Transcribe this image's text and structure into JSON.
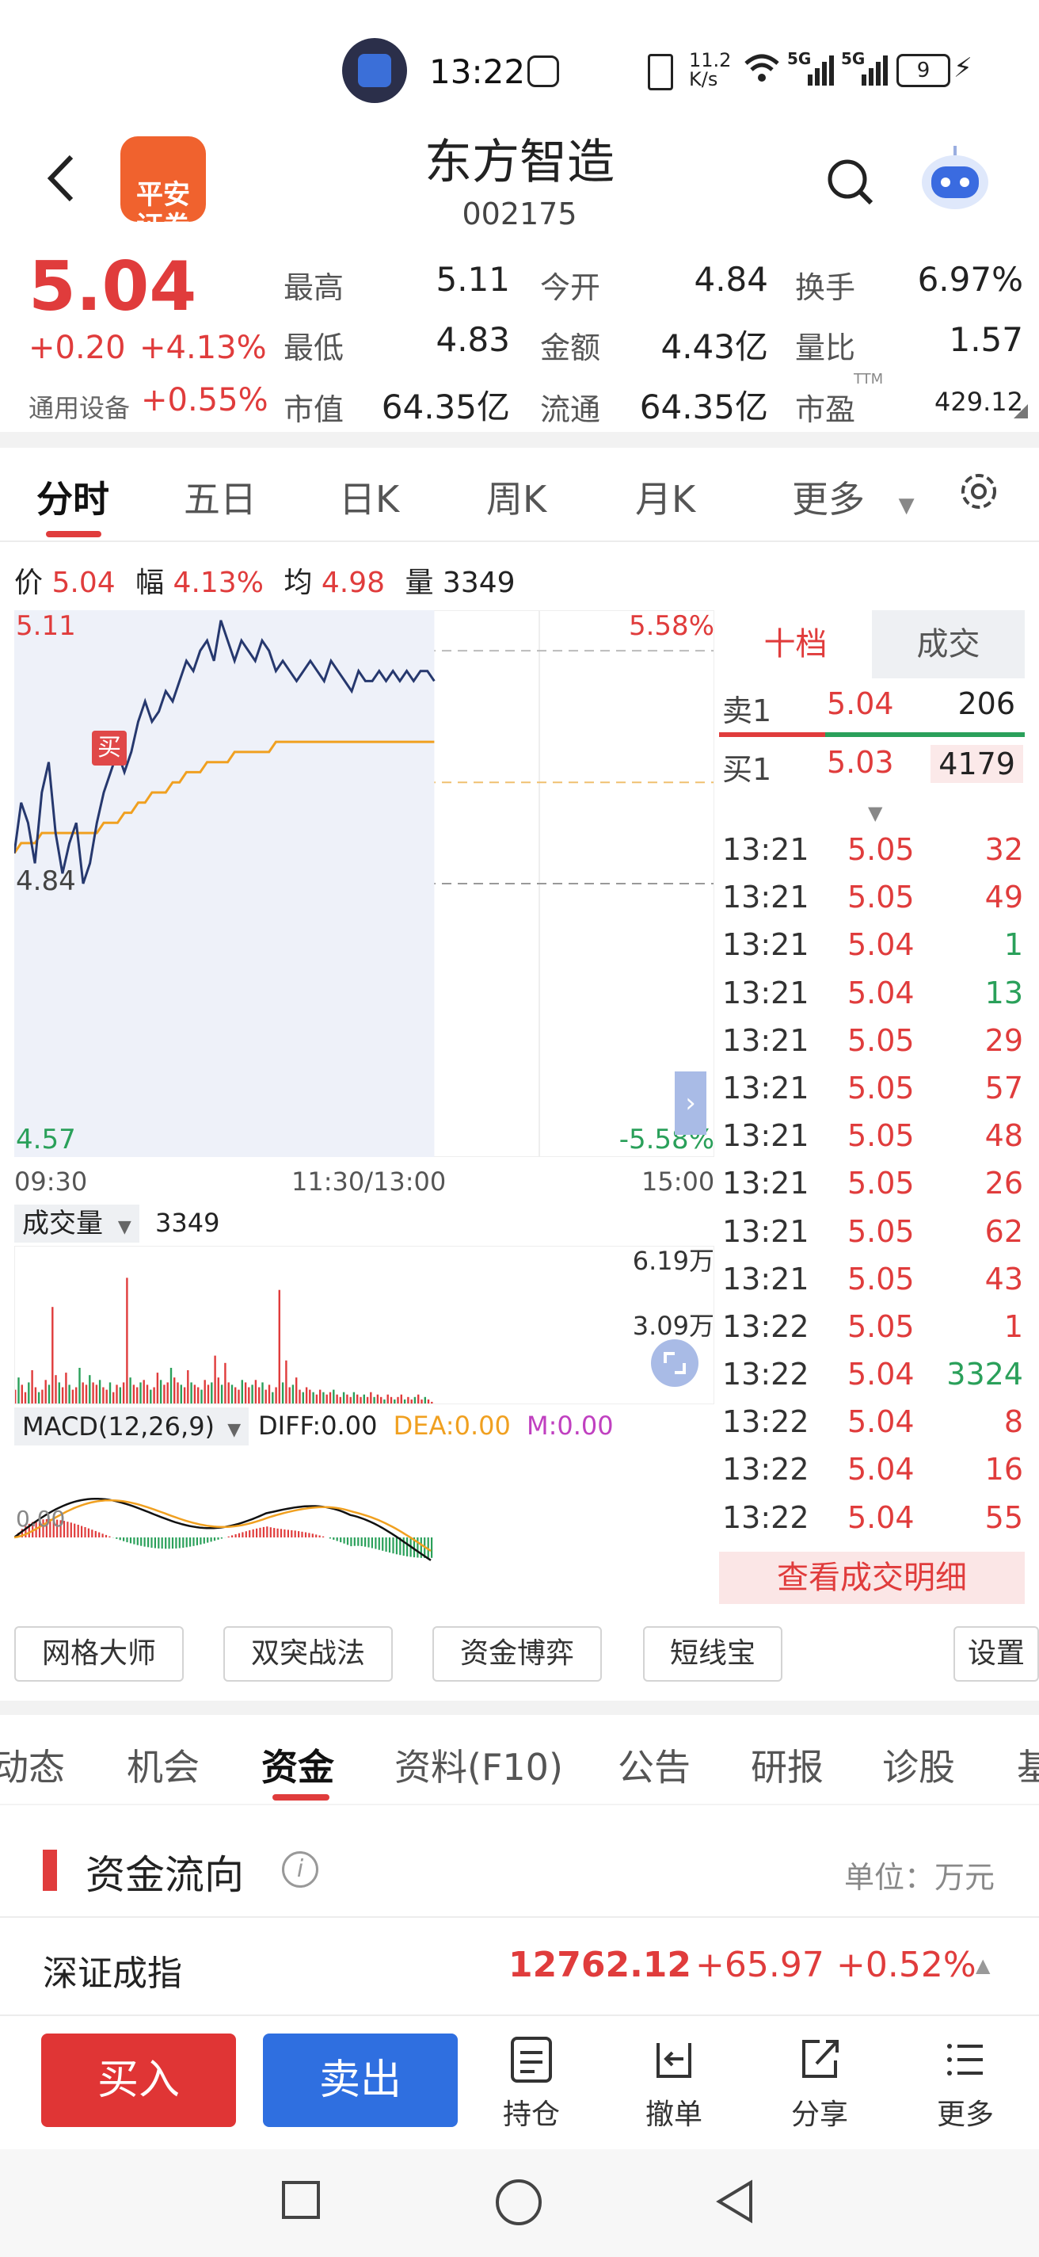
{
  "status_bar": {
    "time": "13:22",
    "net_speed_top": "11.2",
    "net_speed_bottom": "K/s",
    "signal_1": "5G",
    "signal_2": "5G",
    "battery": "9"
  },
  "header": {
    "broker_logo_text": "平安\n证券",
    "stock_name": "东方智造",
    "stock_code": "002175"
  },
  "quote": {
    "price": "5.04",
    "change": "+0.20",
    "change_pct": "+4.13%",
    "sector": "通用设备",
    "sector_pct": "+0.55%",
    "high_label": "最高",
    "high": "5.11",
    "open_label": "今开",
    "open": "4.84",
    "turnover_label": "换手",
    "turnover": "6.97%",
    "low_label": "最低",
    "low": "4.83",
    "amount_label": "金额",
    "amount": "4.43亿",
    "vol_ratio_label": "量比",
    "vol_ratio": "1.57",
    "mcap_label": "市值",
    "mcap": "64.35亿",
    "float_label": "流通",
    "float": "64.35亿",
    "pe_label": "市盈",
    "pe_sup": "TTM",
    "pe": "429.12"
  },
  "chart_tabs": [
    "分时",
    "五日",
    "日K",
    "周K",
    "月K",
    "更多"
  ],
  "chart_info": {
    "price_label": "价",
    "price": "5.04",
    "pct_label": "幅",
    "pct": "4.13%",
    "avg_label": "均",
    "avg": "4.98",
    "vol_label": "量",
    "vol": "3349"
  },
  "chart_data": [
    {
      "type": "line",
      "title": "",
      "x_labels": [
        "09:30",
        "11:30/13:00",
        "15:00"
      ],
      "y_left": [
        "5.11",
        "4.84",
        "4.57"
      ],
      "y_right": [
        "5.58%",
        "-5.58%"
      ],
      "ylim": [
        4.57,
        5.11
      ],
      "marker": "买",
      "series": [
        {
          "values": [
            4.87,
            4.92,
            4.9,
            4.86,
            4.93,
            4.96,
            4.89,
            4.85,
            4.88,
            4.9,
            4.84,
            4.86,
            4.9,
            4.93,
            4.95,
            4.97,
            4.95,
            4.97,
            5.0,
            5.02,
            5.0,
            5.01,
            5.03,
            5.02,
            5.04,
            5.06,
            5.05,
            5.07,
            5.08,
            5.06,
            5.1,
            5.08,
            5.06,
            5.08,
            5.07,
            5.06,
            5.08,
            5.07,
            5.05,
            5.06,
            5.05,
            5.04,
            5.05,
            5.06,
            5.05,
            5.04,
            5.06,
            5.05,
            5.04,
            5.03,
            5.05,
            5.04,
            5.04,
            5.05,
            5.04,
            5.05,
            5.04,
            5.05,
            5.04,
            5.05,
            5.05,
            5.04
          ]
        },
        {
          "values": [
            4.87,
            4.88,
            4.88,
            4.88,
            4.89,
            4.89,
            4.89,
            4.89,
            4.89,
            4.89,
            4.89,
            4.89,
            4.89,
            4.9,
            4.9,
            4.9,
            4.91,
            4.91,
            4.92,
            4.92,
            4.93,
            4.93,
            4.93,
            4.94,
            4.94,
            4.95,
            4.95,
            4.95,
            4.96,
            4.96,
            4.96,
            4.96,
            4.97,
            4.97,
            4.97,
            4.97,
            4.97,
            4.97,
            4.98,
            4.98,
            4.98,
            4.98,
            4.98,
            4.98,
            4.98,
            4.98,
            4.98,
            4.98,
            4.98,
            4.98,
            4.98,
            4.98,
            4.98,
            4.98,
            4.98,
            4.98,
            4.98,
            4.98,
            4.98,
            4.98,
            4.98,
            4.98
          ]
        }
      ]
    },
    {
      "type": "bar",
      "title": "成交量",
      "current": "3349",
      "y_labels": [
        "6.19万",
        "3.09万"
      ],
      "values": [
        0.6,
        1.1,
        0.8,
        0.5,
        0.9,
        1.4,
        0.7,
        0.5,
        0.6,
        1.0,
        0.8,
        4.0,
        1.2,
        0.9,
        0.7,
        1.3,
        0.8,
        0.6,
        0.7,
        1.5,
        0.9,
        0.8,
        1.2,
        0.9,
        0.8,
        1.0,
        0.7,
        0.6,
        0.9,
        0.5,
        0.8,
        0.7,
        0.9,
        5.2,
        1.1,
        0.8,
        0.7,
        0.9,
        1.0,
        0.8,
        0.6,
        0.7,
        1.3,
        1.0,
        0.8,
        0.9,
        1.5,
        1.1,
        0.9,
        0.8,
        0.7,
        1.4,
        0.9,
        0.8,
        0.7,
        0.6,
        1.0,
        0.8,
        0.9,
        2.0,
        1.1,
        0.8,
        1.7,
        0.9,
        0.8,
        0.7,
        0.6,
        1.0,
        0.9,
        0.7,
        0.8,
        1.0,
        0.7,
        0.9,
        0.6,
        0.8,
        0.5,
        0.7,
        4.7,
        0.9,
        1.8,
        0.7,
        0.8,
        1.1,
        0.6,
        0.5,
        0.7,
        0.6,
        0.5,
        0.4,
        0.6,
        0.5,
        0.4,
        0.5,
        0.6,
        0.4,
        0.3,
        0.5,
        0.4,
        0.3,
        0.5,
        0.4,
        0.3,
        0.4,
        0.3,
        0.5,
        0.3,
        0.4,
        0.3,
        0.2,
        0.4,
        0.3,
        0.2,
        0.3,
        0.4,
        0.2,
        0.3,
        0.2,
        0.3,
        0.4,
        0.2,
        0.3,
        0.2,
        0.1
      ]
    },
    {
      "type": "bar",
      "title": "MACD(12,26,9)",
      "diff_label": "DIFF:0.00",
      "dea_label": "DEA:0.00",
      "m_label": "M:0.00",
      "y_label": "0.00"
    }
  ],
  "order_book": {
    "tabs": [
      "十档",
      "成交"
    ],
    "sell1_label": "卖1",
    "sell1_price": "5.04",
    "sell1_vol": "206",
    "buy1_label": "买1",
    "buy1_price": "5.03",
    "buy1_vol": "4179"
  },
  "ticks": [
    {
      "time": "13:21",
      "price": "5.05",
      "vol": "32",
      "dir": "up"
    },
    {
      "time": "13:21",
      "price": "5.05",
      "vol": "49",
      "dir": "up"
    },
    {
      "time": "13:21",
      "price": "5.04",
      "vol": "1",
      "dir": "down"
    },
    {
      "time": "13:21",
      "price": "5.04",
      "vol": "13",
      "dir": "down"
    },
    {
      "time": "13:21",
      "price": "5.05",
      "vol": "29",
      "dir": "up"
    },
    {
      "time": "13:21",
      "price": "5.05",
      "vol": "57",
      "dir": "up"
    },
    {
      "time": "13:21",
      "price": "5.05",
      "vol": "48",
      "dir": "up"
    },
    {
      "time": "13:21",
      "price": "5.05",
      "vol": "26",
      "dir": "up"
    },
    {
      "time": "13:21",
      "price": "5.05",
      "vol": "62",
      "dir": "up"
    },
    {
      "time": "13:21",
      "price": "5.05",
      "vol": "43",
      "dir": "up"
    },
    {
      "time": "13:22",
      "price": "5.05",
      "vol": "1",
      "dir": "up"
    },
    {
      "time": "13:22",
      "price": "5.04",
      "vol": "3324",
      "dir": "down"
    },
    {
      "time": "13:22",
      "price": "5.04",
      "vol": "8",
      "dir": "up"
    },
    {
      "time": "13:22",
      "price": "5.04",
      "vol": "16",
      "dir": "up"
    },
    {
      "time": "13:22",
      "price": "5.04",
      "vol": "55",
      "dir": "up"
    }
  ],
  "view_detail_label": "查看成交明细",
  "tools": [
    "网格大师",
    "双突战法",
    "资金博弈",
    "短线宝",
    "设置"
  ],
  "info_tabs": [
    "动态",
    "机会",
    "资金",
    "资料(F10)",
    "公告",
    "研报",
    "诊股",
    "基"
  ],
  "fund_flow": {
    "title": "资金流向",
    "unit": "单位：万元"
  },
  "index_bar": {
    "name": "深证成指",
    "value": "12762.12",
    "change": "+65.97",
    "pct": "+0.52%"
  },
  "actions": {
    "buy": "买入",
    "sell": "卖出",
    "position": "持仓",
    "cancel": "撤单",
    "share": "分享",
    "more": "更多"
  },
  "colors": {
    "up": "#e03c3c",
    "down": "#2aa05a",
    "price_line": "#26386e",
    "avg_line": "#f0a020",
    "buy_btn": "#e03535",
    "sell_btn": "#2f6fe0"
  }
}
